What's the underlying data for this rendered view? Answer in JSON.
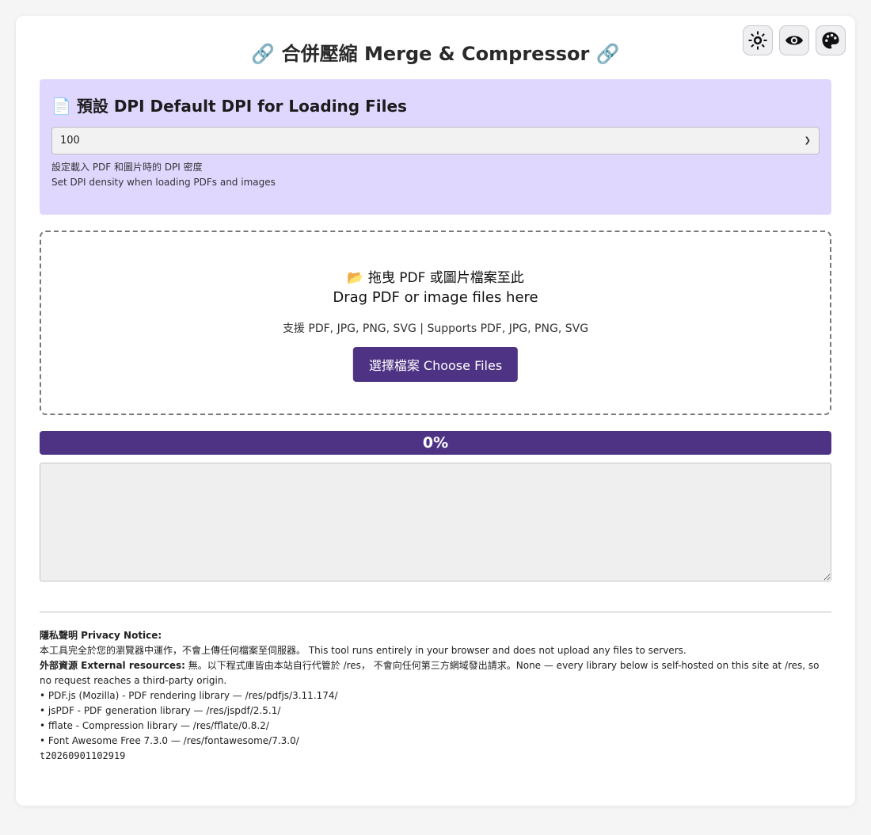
{
  "title": "🔗 合併壓縮 Merge & Compressor 🔗",
  "toolbar": {
    "buttons": [
      {
        "name": "brightness-toggle",
        "icon": "sun-icon"
      },
      {
        "name": "visibility-toggle",
        "icon": "eye-icon"
      },
      {
        "name": "theme-picker",
        "icon": "palette-icon"
      }
    ]
  },
  "dpi": {
    "heading": "📄 預設 DPI Default DPI for Loading Files",
    "selected_value": "100",
    "help_zh": "設定載入 PDF 和圖片時的 DPI 密度",
    "help_en": "Set DPI density when loading PDFs and images"
  },
  "dropzone": {
    "line_zh": "📂 拖曳 PDF 或圖片檔案至此",
    "line_en": "Drag PDF or image files here",
    "supported": "支援 PDF, JPG, PNG, SVG | Supports PDF, JPG, PNG, SVG",
    "choose_label": "選擇檔案 Choose Files"
  },
  "progress": {
    "value_percent": 0,
    "label": "0%"
  },
  "log": {
    "value": ""
  },
  "notice": {
    "privacy_label": "隱私聲明 Privacy Notice:",
    "privacy_text": "本工具完全於您的瀏覽器中運作，不會上傳任何檔案至伺服器。 This tool runs entirely in your browser and does not upload any files to servers.",
    "external_label": "外部資源 External resources:",
    "external_text": " 無。以下程式庫皆由本站自行代管於 /res， 不會向任何第三方網域發出請求。None — every library below is self-hosted on this site at /res, so no request reaches a third-party origin.",
    "libraries": [
      "• PDF.js (Mozilla) - PDF rendering library — /res/pdfjs/3.11.174/",
      "• jsPDF - PDF generation library — /res/jspdf/2.5.1/",
      "• fflate - Compression library — /res/fflate/0.8.2/",
      "• Font Awesome Free 7.3.0 — /res/fontawesome/7.3.0/"
    ],
    "build_id": "t20260901102919"
  },
  "colors": {
    "accent": "#4e3384",
    "dpi_panel_bg": "#e0d7ff"
  }
}
